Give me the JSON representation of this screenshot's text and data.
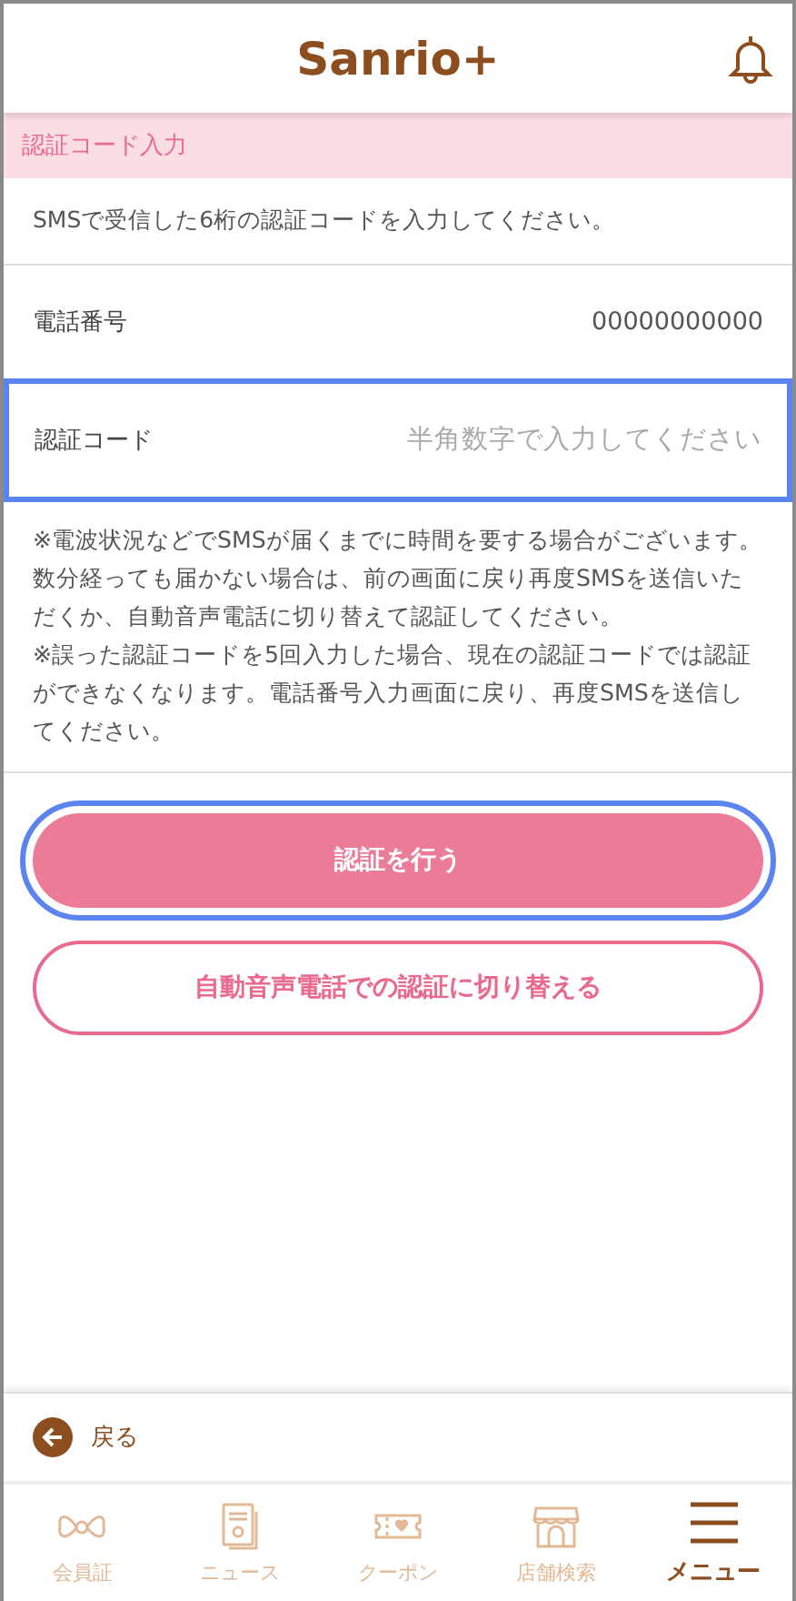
{
  "header": {
    "logo": "Sanrio+"
  },
  "section_title": "認証コード入力",
  "instruction": "SMSで受信した6桁の認証コードを入力してください。",
  "phone": {
    "label": "電話番号",
    "value": "00000000000"
  },
  "code_field": {
    "label": "認証コード",
    "placeholder": "半角数字で入力してください",
    "highlighted": true
  },
  "notes": [
    "※電波状況などでSMSが届くまでに時間を要する場合がございます。数分経っても届かない場合は、前の画面に戻り再度SMSを送信いただくか、自動音声電話に切り替えて認証してください。",
    "※誤った認証コードを5回入力した場合、現在の認証コードでは認証ができなくなります。電話番号入力画面に戻り、再度SMSを送信してください。"
  ],
  "buttons": [
    {
      "label": "認証を行う",
      "kind": "primary",
      "highlighted": true
    },
    {
      "label": "自動音声電話での認証に切り替える",
      "kind": "outline",
      "highlighted": false
    }
  ],
  "back": {
    "label": "戻る"
  },
  "nav": [
    {
      "label": "会員証",
      "selected": false
    },
    {
      "label": "ニュース",
      "selected": false
    },
    {
      "label": "クーポン",
      "selected": false
    },
    {
      "label": "店舗検索",
      "selected": false
    },
    {
      "label": "メニュー",
      "selected": true
    }
  ]
}
